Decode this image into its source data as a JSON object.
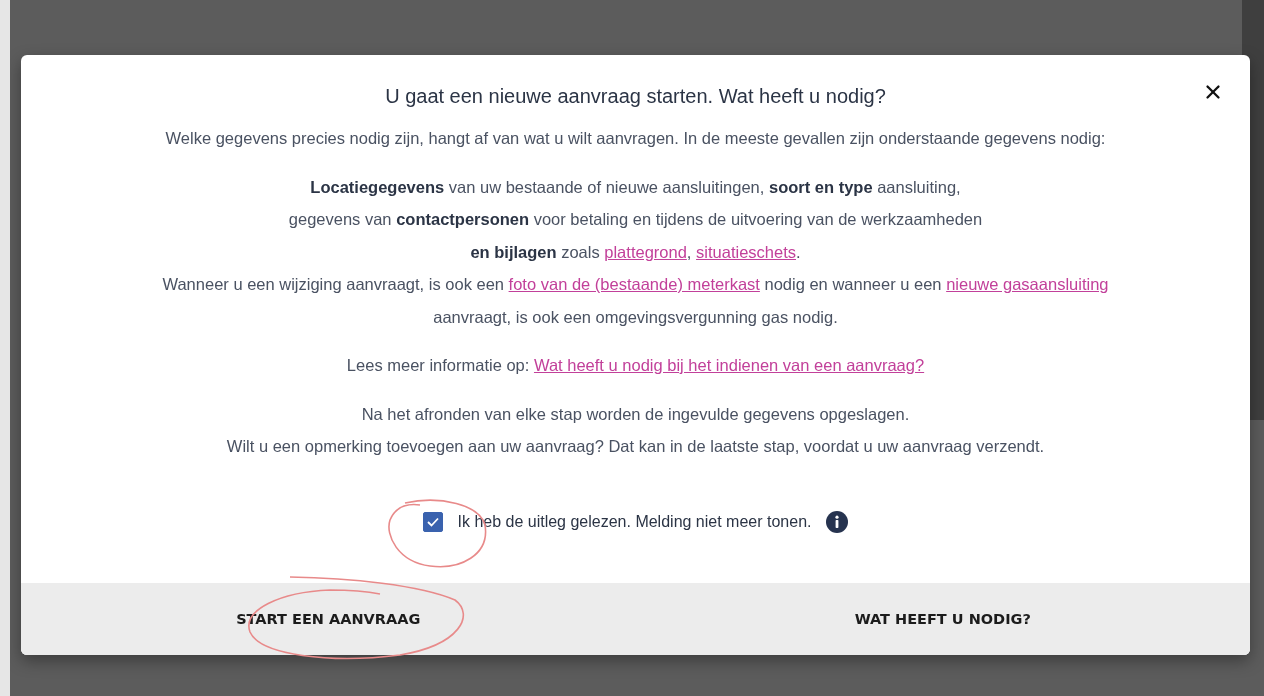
{
  "dialog": {
    "title": "U gaat een nieuwe aanvraag starten. Wat heeft u nodig?",
    "paragraphs": [
      [
        [
          {
            "kind": "plain",
            "text": "Welke gegevens precies nodig zijn, hangt af van wat u wilt aanvragen. In de meeste gevallen zijn onderstaande gegevens nodig:"
          }
        ]
      ],
      [
        [
          {
            "kind": "bold",
            "text": "Locatiegegevens"
          },
          {
            "kind": "plain",
            "text": " van uw bestaande of nieuwe aansluitingen, "
          },
          {
            "kind": "bold",
            "text": "soort en type"
          },
          {
            "kind": "plain",
            "text": " aansluiting,"
          }
        ],
        [
          {
            "kind": "plain",
            "text": "gegevens van "
          },
          {
            "kind": "bold",
            "text": "contactpersonen"
          },
          {
            "kind": "plain",
            "text": " voor betaling en tijdens de uitvoering van de werkzaamheden"
          }
        ],
        [
          {
            "kind": "bold",
            "text": "en bijlagen"
          },
          {
            "kind": "plain",
            "text": " zoals "
          },
          {
            "kind": "link",
            "text": "plattegrond"
          },
          {
            "kind": "plain",
            "text": ", "
          },
          {
            "kind": "link",
            "text": "situatieschets"
          },
          {
            "kind": "plain",
            "text": "."
          }
        ],
        [
          {
            "kind": "plain",
            "text": "Wanneer u een wijziging aanvraagt, is ook een "
          },
          {
            "kind": "link",
            "text": "foto van de (bestaande) meterkast"
          },
          {
            "kind": "plain",
            "text": " nodig en wanneer u een "
          },
          {
            "kind": "link",
            "text": "nieuwe gasaansluiting"
          }
        ],
        [
          {
            "kind": "plain",
            "text": "aanvraagt, is ook een omgevingsvergunning gas nodig."
          }
        ]
      ],
      [
        [
          {
            "kind": "plain",
            "text": "Lees meer informatie op: "
          },
          {
            "kind": "link",
            "text": "Wat heeft u nodig bij het indienen van een aanvraag?"
          }
        ]
      ],
      [
        [
          {
            "kind": "plain",
            "text": "Na het afronden van elke stap worden de ingevulde gegevens opgeslagen."
          }
        ],
        [
          {
            "kind": "plain",
            "text": "Wilt u een opmerking toevoegen aan uw aanvraag? Dat kan in de laatste stap, voordat u uw aanvraag verzendt."
          }
        ]
      ]
    ],
    "checkbox": {
      "label": "Ik heb de uitleg gelezen. Melding niet meer tonen.",
      "checked": true
    },
    "buttons": [
      "START EEN AANVRAAG",
      "WAT HEEFT U NODIG?"
    ]
  }
}
